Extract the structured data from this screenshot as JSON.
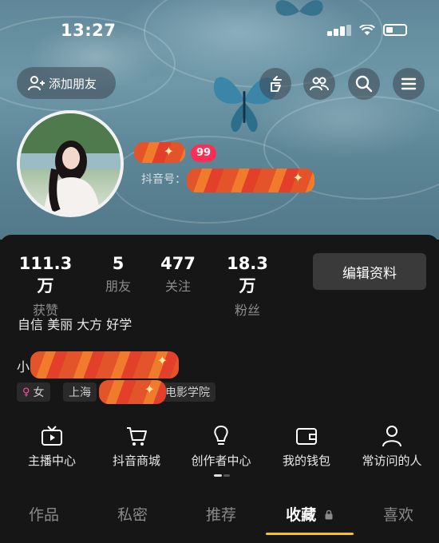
{
  "status_bar": {
    "time": "13:27"
  },
  "header": {
    "add_friend_label": "添加朋友",
    "badge_count": "99",
    "douyin_id_label": "抖音号：",
    "name_prefix": "小"
  },
  "stats": [
    {
      "value": "111.3万",
      "label": "获赞"
    },
    {
      "value": "5",
      "label": "朋友"
    },
    {
      "value": "477",
      "label": "关注"
    },
    {
      "value": "18.3万",
      "label": "粉丝"
    }
  ],
  "edit_profile_label": "编辑资料",
  "bio": "自信 美丽 大方 好学",
  "tags": {
    "gender": "女",
    "city": "上海",
    "school": "电影学院"
  },
  "shortcuts": [
    {
      "label": "主播中心",
      "icon": "tv-icon"
    },
    {
      "label": "抖音商城",
      "icon": "cart-icon"
    },
    {
      "label": "创作者中心",
      "icon": "bulb-icon"
    },
    {
      "label": "我的钱包",
      "icon": "wallet-icon"
    },
    {
      "label": "常访问的人",
      "icon": "person-icon"
    }
  ],
  "tabs": [
    {
      "label": "作品",
      "active": false
    },
    {
      "label": "私密",
      "active": false
    },
    {
      "label": "推荐",
      "active": false
    },
    {
      "label": "收藏",
      "active": true,
      "locked": true
    },
    {
      "label": "喜欢",
      "active": false
    }
  ],
  "colors": {
    "accent_yellow": "#f5c518",
    "badge_red": "#ff2d55",
    "panel_bg": "#161616"
  }
}
